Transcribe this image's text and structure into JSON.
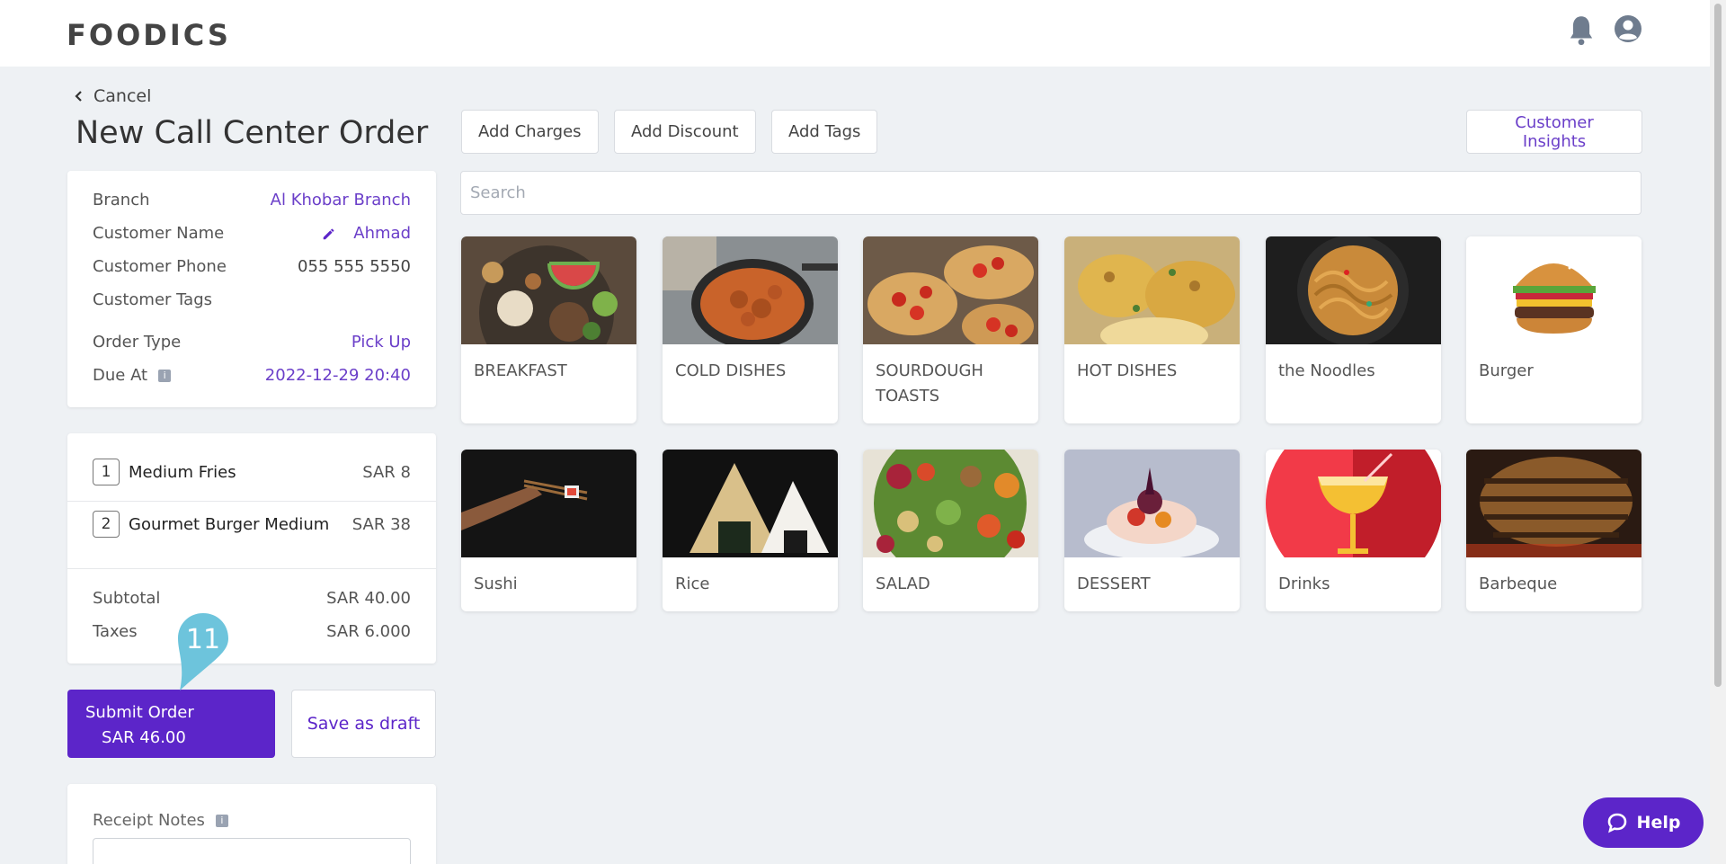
{
  "header": {
    "logo": "FOODICS"
  },
  "nav": {
    "cancel_label": "Cancel"
  },
  "page": {
    "title": "New Call Center Order"
  },
  "toolbar": {
    "add_charges": "Add Charges",
    "add_discount": "Add Discount",
    "add_tags": "Add Tags",
    "customer_insights": "Customer Insights"
  },
  "search": {
    "placeholder": "Search"
  },
  "order_info": {
    "branch_label": "Branch",
    "branch_value": "Al Khobar Branch",
    "customer_name_label": "Customer Name",
    "customer_name_value": "Ahmad",
    "customer_phone_label": "Customer Phone",
    "customer_phone_value": "055 555 5550",
    "customer_tags_label": "Customer Tags",
    "order_type_label": "Order Type",
    "order_type_value": "Pick Up",
    "due_at_label": "Due At",
    "due_at_value": "2022-12-29 20:40"
  },
  "cart": {
    "items": [
      {
        "qty": "1",
        "name": "Medium Fries",
        "price": "SAR 8"
      },
      {
        "qty": "2",
        "name": "Gourmet Burger Medium",
        "price": "SAR 38"
      }
    ],
    "subtotal_label": "Subtotal",
    "subtotal_value": "SAR 40.00",
    "taxes_label": "Taxes",
    "taxes_value": "SAR 6.000"
  },
  "actions": {
    "submit_label": "Submit Order",
    "submit_amount": "SAR 46.00",
    "draft_label": "Save as draft"
  },
  "step_badge": "11",
  "notes": {
    "label": "Receipt Notes"
  },
  "categories": [
    {
      "name": "BREAKFAST"
    },
    {
      "name": "COLD DISHES"
    },
    {
      "name": "SOURDOUGH TOASTS"
    },
    {
      "name": "HOT DISHES"
    },
    {
      "name": "the Noodles"
    },
    {
      "name": "Burger"
    },
    {
      "name": "Sushi"
    },
    {
      "name": "Rice"
    },
    {
      "name": "SALAD"
    },
    {
      "name": "DESSERT"
    },
    {
      "name": "Drinks"
    },
    {
      "name": "Barbeque"
    }
  ],
  "help": {
    "label": "Help"
  },
  "colors": {
    "brand": "#5c25c9",
    "accent_text": "#6b3fc9",
    "background": "#eef1f4"
  }
}
